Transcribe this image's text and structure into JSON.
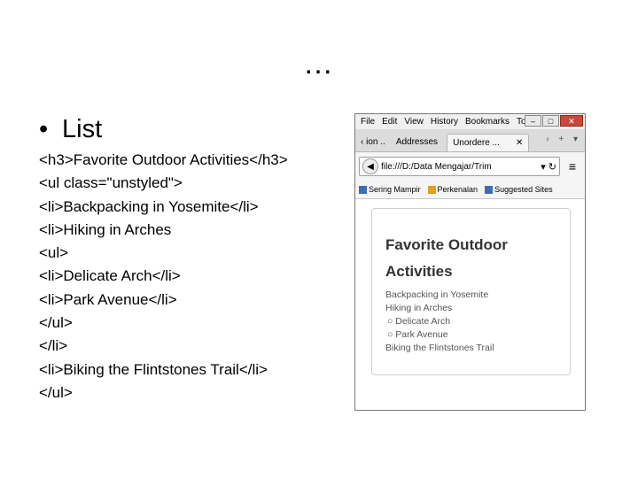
{
  "slide": {
    "title": "…",
    "bullet": "List",
    "code_lines": [
      "<h3>Favorite Outdoor Activities</h3>",
      "<ul class=\"unstyled\">",
      "<li>Backpacking in Yosemite</li>",
      "<li>Hiking in Arches",
      "<ul>",
      "<li>Delicate Arch</li>",
      "<li>Park Avenue</li>",
      "</ul>",
      "</li>",
      "<li>Biking the Flintstones Trail</li>",
      "</ul>"
    ]
  },
  "browser": {
    "menu": [
      "File",
      "Edit",
      "View",
      "History",
      "Bookmarks",
      "To"
    ],
    "tabs": [
      "ion ..",
      "Addresses",
      "Unordere ..."
    ],
    "url": "file:///D:/Data Mengajar/Trim",
    "bookmarks": [
      "Sering Mampir",
      "Perkenalan",
      "Suggested Sites"
    ],
    "page": {
      "heading": "Favorite Outdoor Activities",
      "items": [
        "Backpacking in Yosemite",
        "Hiking in Arches",
        "Biking the Flintstones Trail"
      ],
      "subitems": [
        "Delicate Arch",
        "Park Avenue"
      ]
    }
  }
}
